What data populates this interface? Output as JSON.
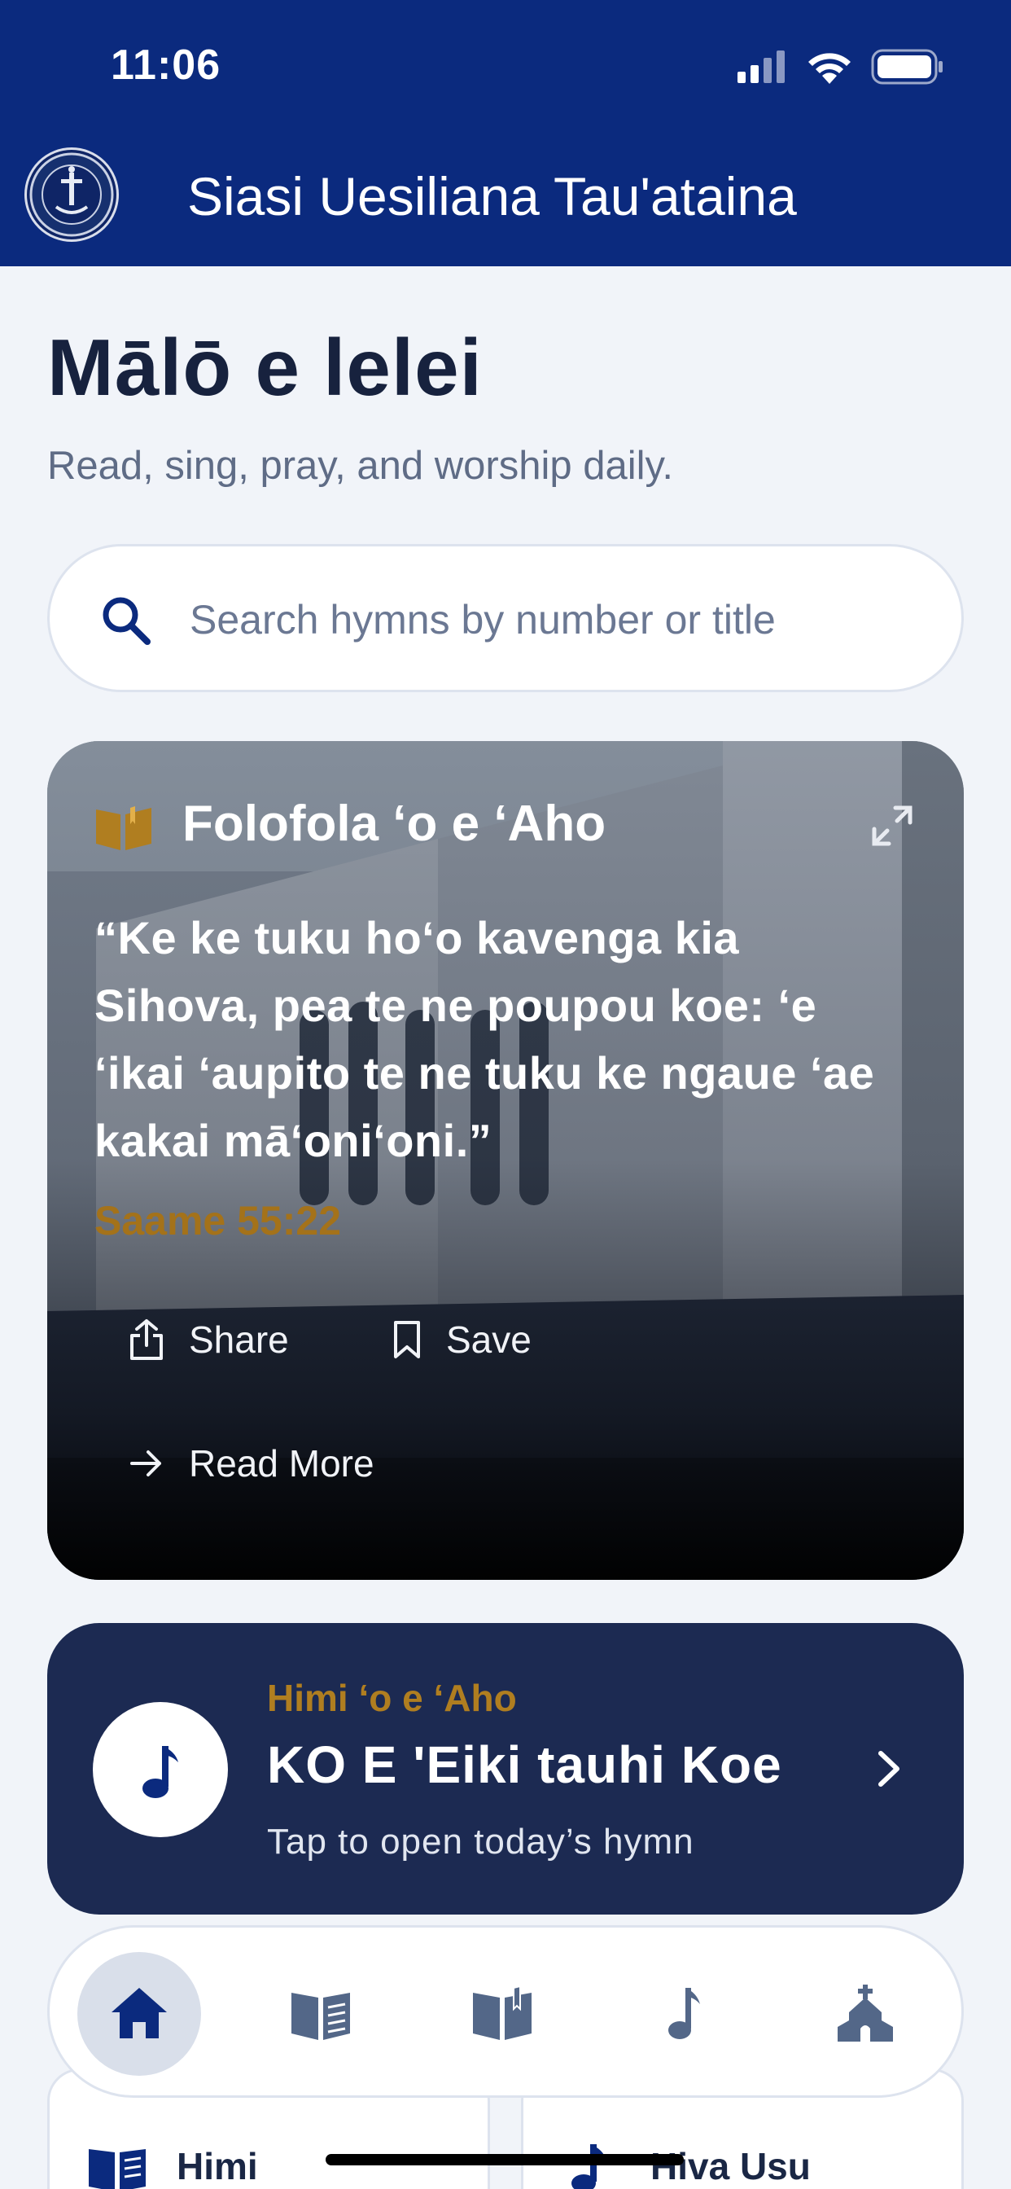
{
  "status_bar": {
    "time": "11:06"
  },
  "header": {
    "title": "Siasi Uesiliana Tau'ataina",
    "logo_icon": "church-seal-logo"
  },
  "greeting": {
    "title": "Mālō e lelei",
    "subtitle": "Read, sing, pray, and worship daily."
  },
  "search": {
    "placeholder": "Search hymns by number or title",
    "value": ""
  },
  "verse_card": {
    "heading": "Folofola ʻo e ʻAho",
    "text": "“Ke ke tuku hoʻo kavenga kia Sihova, pea te ne poupou koe: ʻe ʻikai ʻaupito te ne tuku ke ngaue ʻae kakai māʻoniʻoni.”",
    "reference": "Saame 55:22",
    "actions": {
      "share": "Share",
      "save": "Save",
      "read_more": "Read More"
    }
  },
  "hymn_card": {
    "label": "Himi ʻo e ʻAho",
    "title": "KO E 'Eiki tauhi Koe",
    "subtitle": "Tap to open today’s hymn"
  },
  "quick_cards": [
    {
      "label": "Himi",
      "icon": "hymn-book-icon"
    },
    {
      "label": "Hiva Usu",
      "icon": "music-note-icon"
    }
  ],
  "tabs": [
    {
      "name": "home",
      "icon": "home-icon",
      "active": true
    },
    {
      "name": "hymns",
      "icon": "book-lines-icon",
      "active": false
    },
    {
      "name": "bible",
      "icon": "open-book-icon",
      "active": false
    },
    {
      "name": "music",
      "icon": "music-note-icon",
      "active": false
    },
    {
      "name": "church",
      "icon": "church-icon",
      "active": false
    }
  ],
  "colors": {
    "primary": "#0b2a7e",
    "navy_card": "#1c2a52",
    "gold": "#b07e20",
    "background": "#f1f4f9"
  }
}
